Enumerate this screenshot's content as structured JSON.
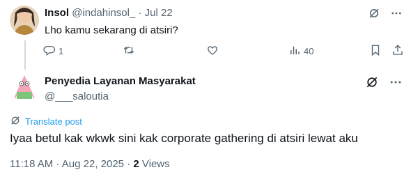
{
  "colors": {
    "text": "#0f1419",
    "muted": "#536471",
    "link": "#1d9bf0",
    "thread_line": "#cfd9de"
  },
  "tweet1": {
    "name": "Insol",
    "handle": "@indahinsol_",
    "separator": "·",
    "date": "Jul 22",
    "text": "Lho kamu sekarang di atsiri?",
    "replies": "1",
    "views": "40",
    "icons": [
      "grok-icon",
      "more-icon",
      "reply-icon",
      "retweet-icon",
      "like-icon",
      "views-icon",
      "bookmark-icon",
      "share-icon"
    ]
  },
  "tweet2": {
    "name": "Penyedia Layanan Masyarakat",
    "handle": "@___saloutia",
    "translate_label": "Translate post",
    "text": "Iyaa betul kak wkwk sini kak corporate gathering di atsiri lewat aku",
    "time": "11:18 AM",
    "date": "Aug 22, 2025",
    "separator": "·",
    "views_count": "2",
    "views_label": "Views",
    "icons": [
      "grok-icon",
      "more-icon",
      "globe-icon"
    ]
  }
}
